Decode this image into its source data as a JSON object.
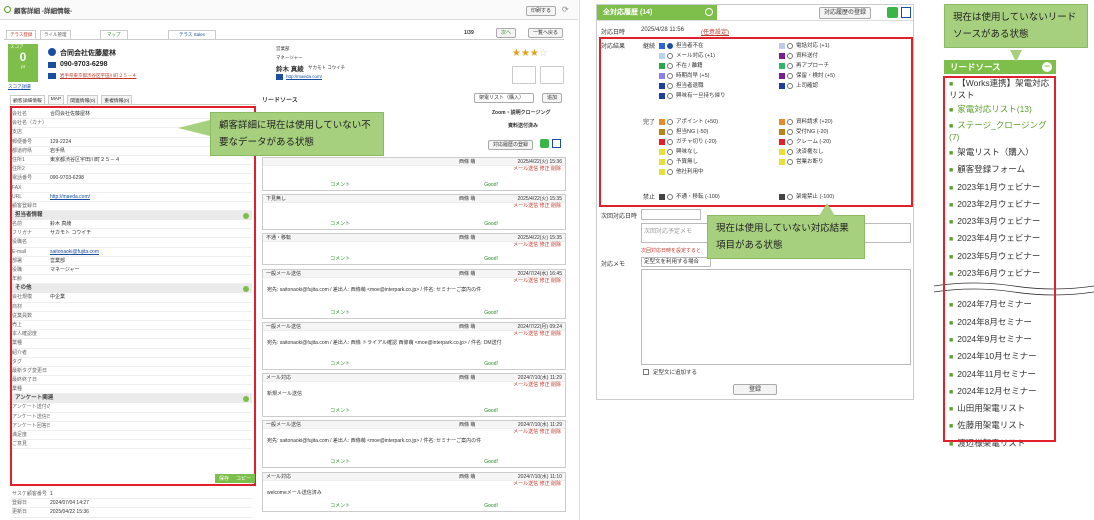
{
  "left": {
    "window_title": "顧客詳細 -詳細情報-",
    "print_btn": "印刷する",
    "tabs": [
      "テラス登録",
      "ライル管理",
      "マップ",
      "テラス Sales"
    ],
    "pager": "1/39",
    "next_btn": "次へ",
    "back_btn": "一覧へ戻る",
    "score_label": "スコア",
    "score_value": "0",
    "score_unit": "pt",
    "score_link": "スコア詳細",
    "company_name": "合同会社佐藤屋林",
    "phone": "090-9703-6298",
    "address_link": "岩手県東京都渋谷区宇田川町２５－４",
    "dept": "営業部",
    "role": "マネージャー",
    "contact_name": "鈴木 真綾",
    "contact_kana": "サカモト コウイチ",
    "url": "http://maeda.com/",
    "subtabs": [
      "顧客詳細情報",
      "MAP",
      "関連情報(0)",
      "重複情報(0)"
    ],
    "fields": [
      {
        "k": "会社名",
        "v": "合同会社佐藤屋林"
      },
      {
        "k": "会社名（カナ）",
        "v": ""
      },
      {
        "k": "支店",
        "v": ""
      },
      {
        "k": "郵便番号",
        "v": "129-2224"
      },
      {
        "k": "都道府県",
        "v": "岩手県"
      },
      {
        "k": "住所1",
        "v": "東京都渋谷区宇田川町２５－４"
      },
      {
        "k": "住所2",
        "v": ""
      },
      {
        "k": "電話番号",
        "v": "090-9703-6298"
      },
      {
        "k": "FAX",
        "v": ""
      },
      {
        "k": "URL",
        "v": "http://maeda.com/"
      },
      {
        "k": "顧客登録日",
        "v": ""
      }
    ],
    "section_person": "担当者情報",
    "person_fields": [
      {
        "k": "名前",
        "v": "鈴木 真綾"
      },
      {
        "k": "フリガナ",
        "v": "サカモト コウイチ"
      },
      {
        "k": "役職名",
        "v": ""
      },
      {
        "k": "E-mail",
        "v": "saitonaoki@fujita.com"
      },
      {
        "k": "部署",
        "v": "営業部"
      },
      {
        "k": "役職",
        "v": "マネージャー"
      },
      {
        "k": "年齢",
        "v": ""
      }
    ],
    "section_other": "その他",
    "other_fields": [
      {
        "k": "会社規模",
        "v": "中企業"
      },
      {
        "k": "商材",
        "v": ""
      },
      {
        "k": "従業員数",
        "v": ""
      },
      {
        "k": "売上",
        "v": ""
      },
      {
        "k": "本人確認度",
        "v": ""
      },
      {
        "k": "業種",
        "v": ""
      },
      {
        "k": "紹介者",
        "v": ""
      },
      {
        "k": "タグ",
        "v": ""
      },
      {
        "k": "最新タグ変更日",
        "v": ""
      },
      {
        "k": "最終終了日",
        "v": ""
      },
      {
        "k": "業種",
        "v": ""
      }
    ],
    "section_survey": "アンケート関連",
    "survey_fields": [
      {
        "k": "アンケート送付の可否",
        "v": ""
      },
      {
        "k": "アンケート送信日",
        "v": ""
      },
      {
        "k": "アンケート回答日",
        "v": ""
      },
      {
        "k": "満足度",
        "v": ""
      },
      {
        "k": "ご意見",
        "v": ""
      }
    ],
    "save_btn": "保存",
    "copy_btn": "コピー",
    "footer": [
      {
        "k": "サスケ顧客番号",
        "v": "1"
      },
      {
        "k": "登録日",
        "v": "2024/07/04 14:27"
      },
      {
        "k": "更新日",
        "v": "2025/04/22 15:36"
      }
    ],
    "callout": "顧客詳細に現在は使用していない不要なデータがある状態"
  },
  "middle": {
    "section_title": "リードソース",
    "select_value": "架電リスト（購入）",
    "add_btn": "追加",
    "lead_row": "Zoom・説明クロージング",
    "lead_row2": "資料送付済み",
    "history_btn": "対応履歴の登録",
    "entries": [
      {
        "title": "",
        "user": "西條 萌",
        "date": "2025/4/22(火) 15:36",
        "body": ""
      },
      {
        "title": "下見無し",
        "user": "西條 萌",
        "date": "2025/4/22(火) 15:35",
        "body": ""
      },
      {
        "title": "不通・移転",
        "user": "西條 萌",
        "date": "2025/4/22(火) 15:35",
        "body": ""
      },
      {
        "title": "一般メール送信",
        "user": "西條 萌",
        "date": "2024/7/24(水) 16:45",
        "body": "宛先: saitonaoki@fujita.com / 差出人: 西條萌 <moe@interpark.co.jp> / 件名: セミナーご案内の件"
      },
      {
        "title": "一般メール送信",
        "user": "西條 萌",
        "date": "2024/7/22(月) 09:24",
        "body": "宛先: saitonaoki@fujita.com / 差出人: 西條 トライアル確認 西條萌 <moe@interpark.co.jp> / 件名: DM送付"
      },
      {
        "title": "メール対応",
        "user": "西條 萌",
        "date": "2024/7/10(水) 11:29",
        "body": "新規メール送信"
      },
      {
        "title": "一般メール送信",
        "user": "西條 萌",
        "date": "2024/7/10(水) 11:29",
        "body": "宛先: saitonaoki@fujita.com / 差出人: 西條萌 <moe@interpark.co.jp> / 件名: セミナーご案内の件"
      },
      {
        "title": "メール対応",
        "user": "西條 萌",
        "date": "2024/7/10(水) 11:10",
        "body": "welcomeメール送信済み"
      }
    ],
    "comment": "コメント",
    "good": "Good!",
    "mail_link": "メール送信",
    "edit": "修正",
    "del": "削除",
    "show_mail": "メール本文を表示"
  },
  "center": {
    "title": "全対応履歴 (14)",
    "history_btn": "対応履歴の登録",
    "date_label": "対応日時",
    "date_value": "2025/4/28 11:56",
    "date_link": "(任意設定)",
    "result_label": "対応結果",
    "cont_label": "継続",
    "cont_opts": [
      {
        "c": "#2b63d9",
        "t": "担当者不在"
      },
      {
        "c": "#bfc9e8",
        "t": "電話対応 (+1)"
      },
      {
        "c": "#b9d3ef",
        "t": "メール対応 (+1)"
      },
      {
        "c": "#7a1f8f",
        "t": "資料送付"
      },
      {
        "c": "#2aa84a",
        "t": "不在 / 離籍"
      },
      {
        "c": "#33b36b",
        "t": "再アプローチ"
      },
      {
        "c": "#8a7ff0",
        "t": "時期尚早 (+5)"
      },
      {
        "c": "#7a1f8f",
        "t": "保留・検討 (+5)"
      },
      {
        "c": "#1c3fa0",
        "t": "担当者退職"
      },
      {
        "c": "#1c3fa0",
        "t": "上司確認"
      },
      {
        "c": "#1c3fa0",
        "t": "興味有一旦持ち帰り"
      }
    ],
    "done_label": "完了",
    "done_opts": [
      {
        "c": "#e78a2b",
        "t": "アポイント (+50)"
      },
      {
        "c": "#e78a2b",
        "t": "資料請求 (+20)"
      },
      {
        "c": "#b5841a",
        "t": "担当NG (-50)"
      },
      {
        "c": "#b5841a",
        "t": "受付NG (-20)"
      },
      {
        "c": "#e0202a",
        "t": "ガチャ切り (-20)"
      },
      {
        "c": "#e0202a",
        "t": "クレーム (-20)"
      },
      {
        "c": "#e8e03a",
        "t": "興味なし"
      },
      {
        "c": "#e8e03a",
        "t": "決済権なし"
      },
      {
        "c": "#e8e03a",
        "t": "予算無し"
      },
      {
        "c": "#e8e03a",
        "t": "営業お断り"
      },
      {
        "c": "#e8e03a",
        "t": "他社利用中"
      }
    ],
    "ban_label": "禁止",
    "ban_opts": [
      {
        "c": "#444",
        "t": "不通・移転 (-100)"
      },
      {
        "c": "#444",
        "t": "架電禁止 (-100)"
      }
    ],
    "next_label": "次回対応日時",
    "next_placeholder": "次回対応予定メモ",
    "next_note": "次回対応日時を設定すると",
    "memo_label": "対応メモ",
    "memo_placeholder": "定型文を利用する場合",
    "append_label": "定型文に追加する",
    "submit": "登録",
    "callout": "現在は使用していない対応結果項目がある状態"
  },
  "right": {
    "callout": "現在は使用していないリードソースがある状態",
    "header": "リードソース",
    "items_top": [
      {
        "t": "【Works連携】架電対応リスト",
        "tag": ""
      },
      {
        "t": "家電対応リスト(13)",
        "tag": "green"
      },
      {
        "t": "ステージ_クロージング(7)",
        "tag": "green"
      }
    ],
    "items_mid": [
      "架電リスト（購入）",
      "顧客登録フォーム",
      "2023年1月ウェビナー",
      "2023年2月ウェビナー",
      "2023年3月ウェビナー",
      "2023年4月ウェビナー",
      "2023年5月ウェビナー",
      "2023年6月ウェビナー"
    ],
    "items_bot": [
      "2024年7月セミナー",
      "2024年8月セミナー",
      "2024年9月セミナー",
      "2024年10月セミナー",
      "2024年11月セミナー",
      "2024年12月セミナー",
      "山田用架電リスト",
      "佐藤用架電リスト",
      "渡辺様架電リスト"
    ]
  }
}
